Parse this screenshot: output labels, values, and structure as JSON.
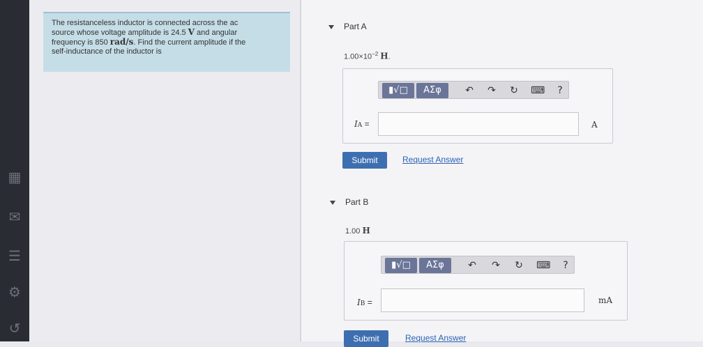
{
  "problem": {
    "line1": "The resistanceless inductor is connected across the ac",
    "line2a": "source whose voltage amplitude is 24.5 ",
    "line2_unit": "V",
    "line2b": " and angular",
    "line3a": "frequency is 850 ",
    "line3_unit": "rad/s",
    "line3b": ". Find the current amplitude if the",
    "line4": "self-inductance of the inductor is"
  },
  "part_a": {
    "title": "Part A",
    "given_mant": "1.00×10",
    "given_exp": "−2",
    "given_unit": "H",
    "given_dot": ".",
    "toolbar": {
      "templates": "▮√□",
      "symbols": "ΑΣφ",
      "undo": "↶",
      "redo": "↷",
      "reset": "↻",
      "keyboard": "⌨",
      "help": "?"
    },
    "label_var": "I",
    "label_sub": "A",
    "label_eq": " =",
    "input_value": "",
    "unit": "A",
    "submit": "Submit",
    "request": "Request Answer"
  },
  "part_b": {
    "title": "Part B",
    "given_value": "1.00 ",
    "given_unit": "H",
    "toolbar": {
      "templates": "▮√□",
      "symbols": "ΑΣφ",
      "undo": "↶",
      "redo": "↷",
      "reset": "↻",
      "keyboard": "⌨",
      "help": "?"
    },
    "label_var": "I",
    "label_sub": "B",
    "label_eq": " =",
    "input_value": "",
    "unit": "mA",
    "submit": "Submit",
    "request": "Request Answer"
  },
  "sidebar": {
    "icons": [
      "calendar-icon",
      "mail-icon",
      "notes-icon",
      "gear-icon",
      "logout-icon"
    ]
  }
}
